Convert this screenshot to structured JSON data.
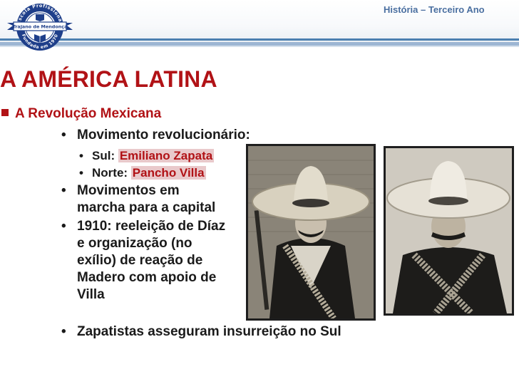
{
  "header": {
    "course": "História – Terceiro Ano",
    "logo": {
      "top_text": "Escola Profissional",
      "banner_text": "Trajano de Mendonça",
      "bottom_text": "Fundada em 1970"
    }
  },
  "slide": {
    "title": "A AMÉRICA LATINA",
    "section": "A Revolução Mexicana",
    "bullets": {
      "b1": "Movimento revolucionário:",
      "south_label": "Sul:",
      "south_name": "Emiliano Zapata",
      "north_label": "Norte:",
      "north_name": "Pancho Villa",
      "b2_line1": "Movimentos em",
      "b2_line2": "marcha para a capital",
      "b3_line1": "1910: reeleição de Díaz",
      "b3_line2": "e organização (no",
      "b3_line3": "exílio) de reação de",
      "b3_line4": "Madero com apoio de",
      "b3_line5": "Villa",
      "b4": "Zapatistas asseguram insurreição no Sul"
    }
  },
  "colors": {
    "title_red": "#b11216",
    "highlight_pink": "#e9c9cb",
    "header_blue": "#4b7fb0",
    "course_blue": "#4a6fa0"
  },
  "images": {
    "left_photo": "portrait-zapata-photo",
    "right_photo": "portrait-villa-photo"
  }
}
